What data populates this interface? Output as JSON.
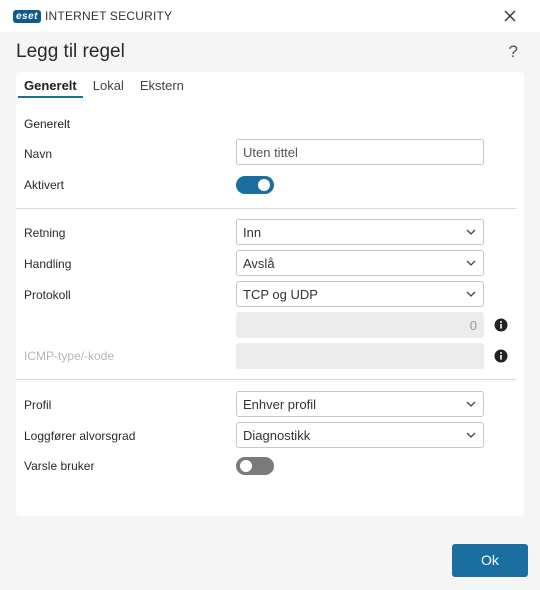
{
  "app": {
    "logo_badge": "eset",
    "product_name": "INTERNET SECURITY"
  },
  "dialog": {
    "title": "Legg til regel",
    "help_label": "?"
  },
  "tabs": [
    {
      "label": "Generelt",
      "active": true
    },
    {
      "label": "Lokal",
      "active": false
    },
    {
      "label": "Ekstern",
      "active": false
    }
  ],
  "general": {
    "section_title": "Generelt",
    "name_label": "Navn",
    "name_placeholder": "Uten tittel",
    "enabled_label": "Aktivert",
    "enabled_value": true
  },
  "rule": {
    "direction_label": "Retning",
    "direction_value": "Inn",
    "action_label": "Handling",
    "action_value": "Avslå",
    "protocol_label": "Protokoll",
    "protocol_value": "TCP og UDP",
    "protocol_number_value": "0",
    "icmp_label": "ICMP-type/-kode",
    "icmp_value": ""
  },
  "logging": {
    "profile_label": "Profil",
    "profile_value": "Enhver profil",
    "log_severity_label": "Loggfører alvorsgrad",
    "log_severity_value": "Diagnostikk",
    "notify_user_label": "Varsle bruker",
    "notify_user_value": false
  },
  "footer": {
    "ok_label": "Ok"
  },
  "colors": {
    "accent": "#1a6fa0",
    "toggle_off": "#7a7a7a",
    "background": "#f5f5f5"
  },
  "icons": {
    "close": "close-icon",
    "chevron": "chevron-down-icon",
    "info": "info-icon"
  }
}
